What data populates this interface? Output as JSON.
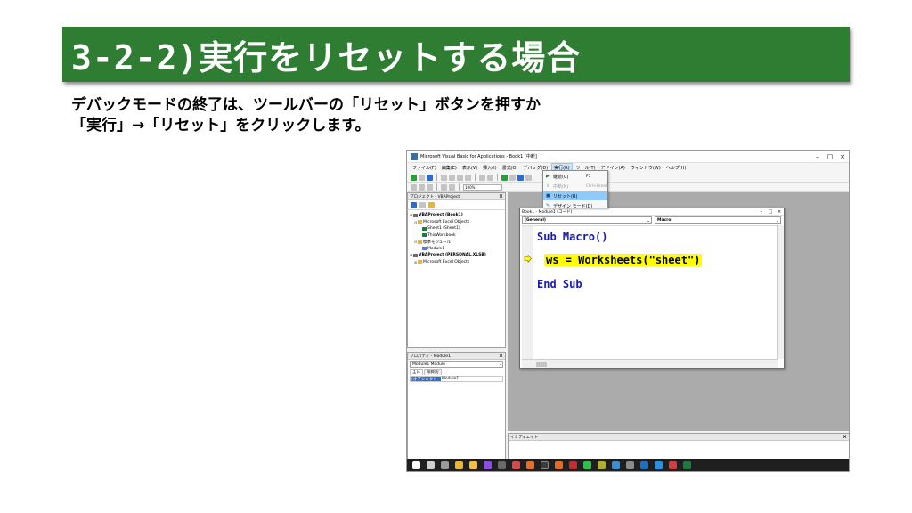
{
  "slide": {
    "title": "3-2-2)実行をリセットする場合",
    "line1": "デバックモードの終了は、ツールバーの「リセット」ボタンを押すか",
    "line2": "「実行」→「リセット」をクリックします。",
    "accent": "#2e7d32"
  },
  "vbe": {
    "window_title": "Microsoft Visual Basic for Applications - Book1 [中断]",
    "menus": [
      "ファイル(F)",
      "編集(E)",
      "表示(V)",
      "挿入(I)",
      "書式(O)",
      "デバッグ(D)",
      "実行(R)",
      "ツール(T)",
      "アドイン(A)",
      "ウィンドウ(W)",
      "ヘルプ(H)"
    ],
    "active_menu_index": 6,
    "toolbar_zoom": "100%",
    "run_menu": {
      "items": [
        {
          "label": "継続(C)",
          "shortcut": "F5",
          "state": "normal"
        },
        {
          "label": "中断(K)",
          "shortcut": "Ctrl+Break",
          "state": "disabled"
        },
        {
          "label": "リセット(R)",
          "shortcut": "",
          "state": "highlighted"
        },
        {
          "label": "デザイン モード(D)",
          "shortcut": "",
          "state": "normal"
        }
      ]
    },
    "project_pane": {
      "title": "プロジェクト - VBAProject",
      "tree": [
        {
          "label": "VBAProject (Book1)",
          "icon": "project-icon",
          "level": 0,
          "bold": true
        },
        {
          "label": "Microsoft Excel Objects",
          "icon": "folder-icon",
          "level": 1,
          "bold": false
        },
        {
          "label": "Sheet1 (Sheet1)",
          "icon": "sheet-icon",
          "level": 2,
          "bold": false
        },
        {
          "label": "ThisWorkbook",
          "icon": "workbook-icon",
          "level": 2,
          "bold": false
        },
        {
          "label": "標準モジュール",
          "icon": "folder-icon",
          "level": 1,
          "bold": false
        },
        {
          "label": "Module1",
          "icon": "module-icon",
          "level": 2,
          "bold": false
        },
        {
          "label": "VBAProject (PERSONAL.XLSB)",
          "icon": "project-icon",
          "level": 0,
          "bold": true
        },
        {
          "label": "Microsoft Excel Objects",
          "icon": "folder-icon",
          "level": 1,
          "bold": false
        }
      ]
    },
    "properties_pane": {
      "title": "プロパティ - Module1",
      "selected_object": "Module1 Module",
      "tabs": [
        "全体",
        "項目別"
      ],
      "row_key": "(オブジェクト名)",
      "row_value": "Module1"
    },
    "code_window": {
      "title": "Book1 - Module1 (コード)",
      "object_select": "(General)",
      "proc_select": "Macro",
      "line1": "Sub Macro()",
      "line2": "ws = Worksheets(\"sheet\")",
      "line3": "End Sub"
    },
    "immediate_pane": {
      "title": "イミディエイト"
    },
    "taskbar_icons": [
      "windows-icon",
      "search-icon",
      "taskview-icon",
      "chrome-icon",
      "explorer-icon",
      "messenger-icon",
      "store-icon",
      "photos-icon",
      "app-icon",
      "terminal-icon",
      "paint-icon",
      "app-icon",
      "line-icon",
      "app-icon",
      "app-icon",
      "app-icon",
      "outlook-icon",
      "vscode-icon",
      "app-icon",
      "excel-icon"
    ]
  }
}
